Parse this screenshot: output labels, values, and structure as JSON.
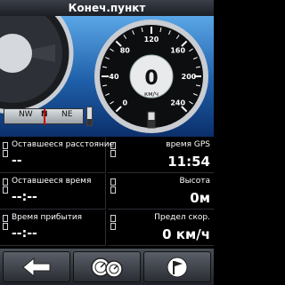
{
  "title_bar": {
    "title": "Конеч.пункт"
  },
  "speedometer": {
    "speed_value": "0",
    "speed_unit": "км/ч",
    "scale_labels": [
      "0",
      "40",
      "80",
      "120",
      "160",
      "200",
      "240"
    ]
  },
  "compass": {
    "labels": [
      "NW",
      "N",
      "NE"
    ],
    "level": 0.35
  },
  "fields": [
    {
      "label": "Оставшееся расстояние",
      "value": "--"
    },
    {
      "label": "время GPS",
      "value": "11:54"
    },
    {
      "label": "Оставшееся время",
      "value": "--:--"
    },
    {
      "label": "Высота",
      "value": "0м"
    },
    {
      "label": "Время прибытия",
      "value": "--:--"
    },
    {
      "label": "Предел скор.",
      "value": "0 км/ч"
    }
  ],
  "toolbar": {
    "buttons": [
      "back-icon",
      "gauges-icon",
      "flag-icon"
    ]
  },
  "colors": {
    "dash_blue": "#1e5ea8",
    "needle_red": "#c00000",
    "background": "#000000"
  }
}
